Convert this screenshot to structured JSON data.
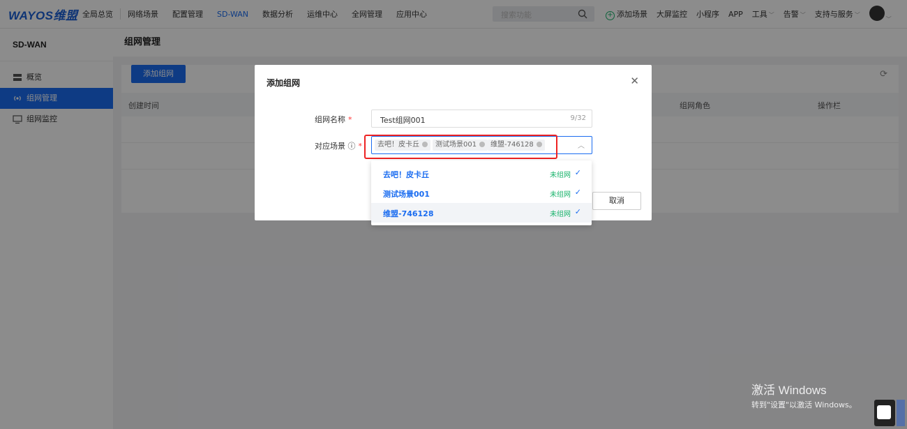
{
  "topbar": {
    "logo": "WAYOS维盟",
    "nav": [
      "全局总览",
      "网络场景",
      "配置管理",
      "SD-WAN",
      "数据分析",
      "运维中心",
      "全网管理",
      "应用中心"
    ],
    "active_nav": "SD-WAN",
    "search_placeholder": "搜索功能",
    "right": {
      "add_scene": "添加场景",
      "items": [
        "大屏监控",
        "小程序",
        "APP"
      ],
      "tools": "工具",
      "alarm": "告警",
      "support": "支持与服务"
    }
  },
  "sidebar": {
    "title": "SD-WAN",
    "items": [
      {
        "label": "概览",
        "icon": "overview-icon"
      },
      {
        "label": "组网管理",
        "icon": "network-icon"
      },
      {
        "label": "组网监控",
        "icon": "monitor-icon"
      }
    ]
  },
  "main": {
    "title": "组网管理",
    "add_button": "添加组网",
    "columns": [
      "创建时间",
      "组网角色",
      "操作栏"
    ]
  },
  "modal": {
    "title": "添加组网",
    "name_label": "组网名称",
    "name_value": "Test组网001",
    "name_count": "9/32",
    "scene_label": "对应场景 ⓘ",
    "selected_tags": [
      "去吧！皮卡丘",
      "测试场景001",
      "维盟-746128"
    ],
    "cancel_label": "取消"
  },
  "dropdown": {
    "options": [
      {
        "name": "去吧！皮卡丘",
        "status": "未组网",
        "checked": true
      },
      {
        "name": "测试场景001",
        "status": "未组网",
        "checked": true
      },
      {
        "name": "维盟-746128",
        "status": "未组网",
        "checked": true
      }
    ]
  },
  "watermark": {
    "line1": "激活 Windows",
    "line2": "转到\"设置\"以激活 Windows。"
  },
  "colors": {
    "accent": "#1a6cf0",
    "success": "#19b36b",
    "highlight_box": "#e22222"
  }
}
